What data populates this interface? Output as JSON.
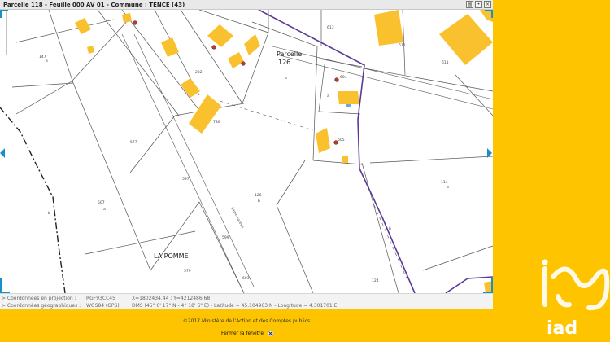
{
  "window": {
    "title": "Parcelle 118 - Feuille 000 AV 01 - Commune : TENCE (43)",
    "icons": [
      "print-icon",
      "pin-icon",
      "close-icon"
    ]
  },
  "map": {
    "selected_parcel_label_line1": "Parcelle",
    "selected_parcel_label_line2": "126",
    "locality_name": "LA POMME",
    "road_label": "Saint-Agrève",
    "parcel_numbers": [
      "147",
      "a",
      "232",
      "786",
      "577",
      "597",
      "507",
      "a",
      "b",
      "126",
      "b",
      "599",
      "579",
      "603",
      "613",
      "612",
      "611",
      "604",
      "605",
      "114",
      "a",
      "124",
      "b",
      "a",
      "a"
    ],
    "colors": {
      "building": "#F9C12E",
      "boundary_line": "#555555",
      "commune_boundary": "#5B3A96",
      "arrow": "#1A90C8"
    },
    "icons": [
      "nav-left-icon",
      "nav-right-icon",
      "corner-icon",
      "building-marker-icon"
    ]
  },
  "coordinates": {
    "projection_label": "> Coordonnées en projection :",
    "projection_system": "RGF93CC45",
    "projection_value": "X=1802434.44 ; Y=4212486.68",
    "geo_label": "> Coordonnées géographiques :",
    "geo_system": "WGS84 (GPS)",
    "geo_value": "DMS (45° 6' 17\" N - 4° 18' 6\" E) - Latitude = 45.104963 N - Longitude = 4.301701 E"
  },
  "footer": {
    "copyright": "©2017 Ministère de l'Action et des Comptes publics",
    "close_label": "Fermer la fenêtre"
  },
  "brand": {
    "logo_text": "iad",
    "color": "#FFC400"
  }
}
